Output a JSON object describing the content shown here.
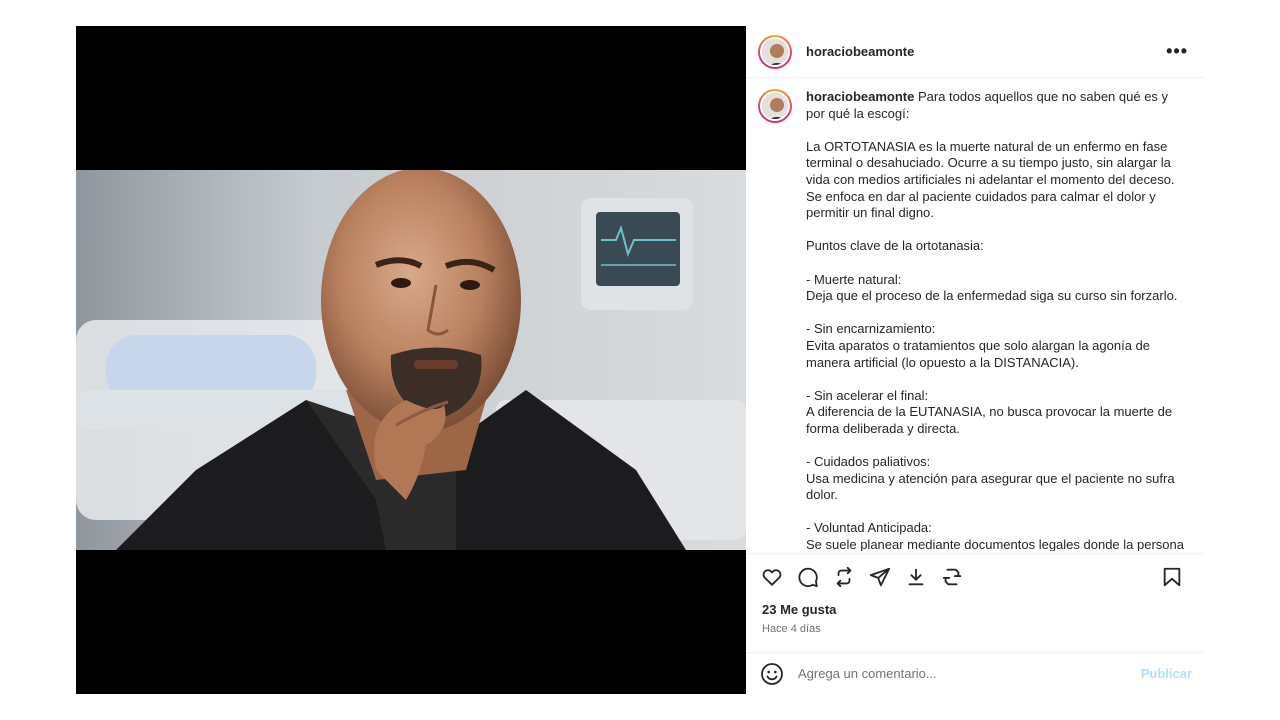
{
  "post": {
    "username": "horaciobeamonte",
    "more_icon": "more-horizontal-icon",
    "caption": {
      "username": "horaciobeamonte",
      "text": " Para todos aquellos que no saben qué es y por qué la escogí:\n\nLa ORTOTANASIA es la muerte natural de un enfermo en fase terminal o desahuciado. Ocurre a su tiempo justo, sin alargar la vida con medios artificiales ni adelantar el momento del deceso. Se enfoca en dar al paciente cuidados para calmar el dolor y permitir un final digno.\n\nPuntos clave de la ortotanasia:\n\n- Muerte natural:\nDeja que el proceso de la enfermedad siga su curso sin forzarlo.\n\n- Sin encarnizamiento:\nEvita aparatos o tratamientos que solo alargan la agonía de manera artificial (lo opuesto a la DISTANACIA).\n\n- Sin acelerar el final:\nA diferencia de la EUTANASIA, no busca provocar la muerte de forma deliberada y directa.\n\n- Cuidados paliativos:\nUsa medicina y atención para asegurar que el paciente no sufra dolor.\n\n- Voluntad Anticipada:\nSe suele planear mediante documentos legales donde la persona elige cuidados y rechaza tratamientos artificiales."
    },
    "actions": {
      "like_icon": "heart-icon",
      "comment_icon": "comment-icon",
      "repost_icon": "repost-icon",
      "share_icon": "send-icon",
      "download_icon": "download-icon",
      "extension_icon": "convert-icon",
      "save_icon": "bookmark-icon"
    },
    "likes": "23 Me gusta",
    "time": "Hace 4 días",
    "comment": {
      "placeholder": "Agrega un comentario...",
      "publish_label": "Publicar",
      "emoji_icon": "emoji-icon"
    }
  }
}
